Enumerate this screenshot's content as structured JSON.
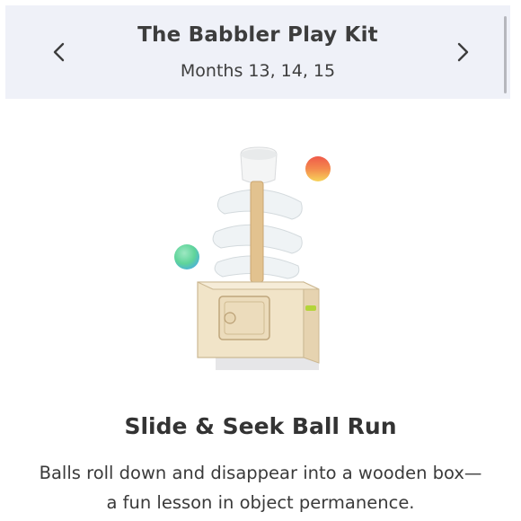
{
  "header": {
    "title": "The Babbler Play Kit",
    "subtitle": "Months 13, 14, 15",
    "prev_icon": "chevron-left-icon",
    "next_icon": "chevron-right-icon"
  },
  "product": {
    "name": "Slide & Seek Ball Run",
    "description": "Balls roll down and disappear into a wooden box—a fun lesson in object permanence."
  },
  "colors": {
    "header_bg": "#eff1f8",
    "text": "#3d3d3d",
    "wood": "#eedfc3",
    "ball_green": "#5fd49a",
    "ball_red": "#ef5a4a",
    "ball_yellow": "#f7d35a"
  }
}
